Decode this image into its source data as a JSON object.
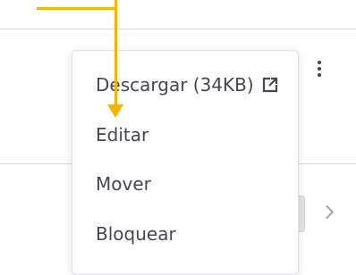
{
  "menu": {
    "items": [
      {
        "label": "Descargar (34KB)",
        "icon": "external-link-icon"
      },
      {
        "label": "Editar"
      },
      {
        "label": "Mover"
      },
      {
        "label": "Bloquear"
      }
    ]
  },
  "icons": {
    "more": "vertical-ellipsis-icon",
    "next": "chevron-right-icon"
  },
  "colors": {
    "annotation": "#f4b400",
    "text": "#44474d",
    "divider": "#d7d9dc"
  }
}
